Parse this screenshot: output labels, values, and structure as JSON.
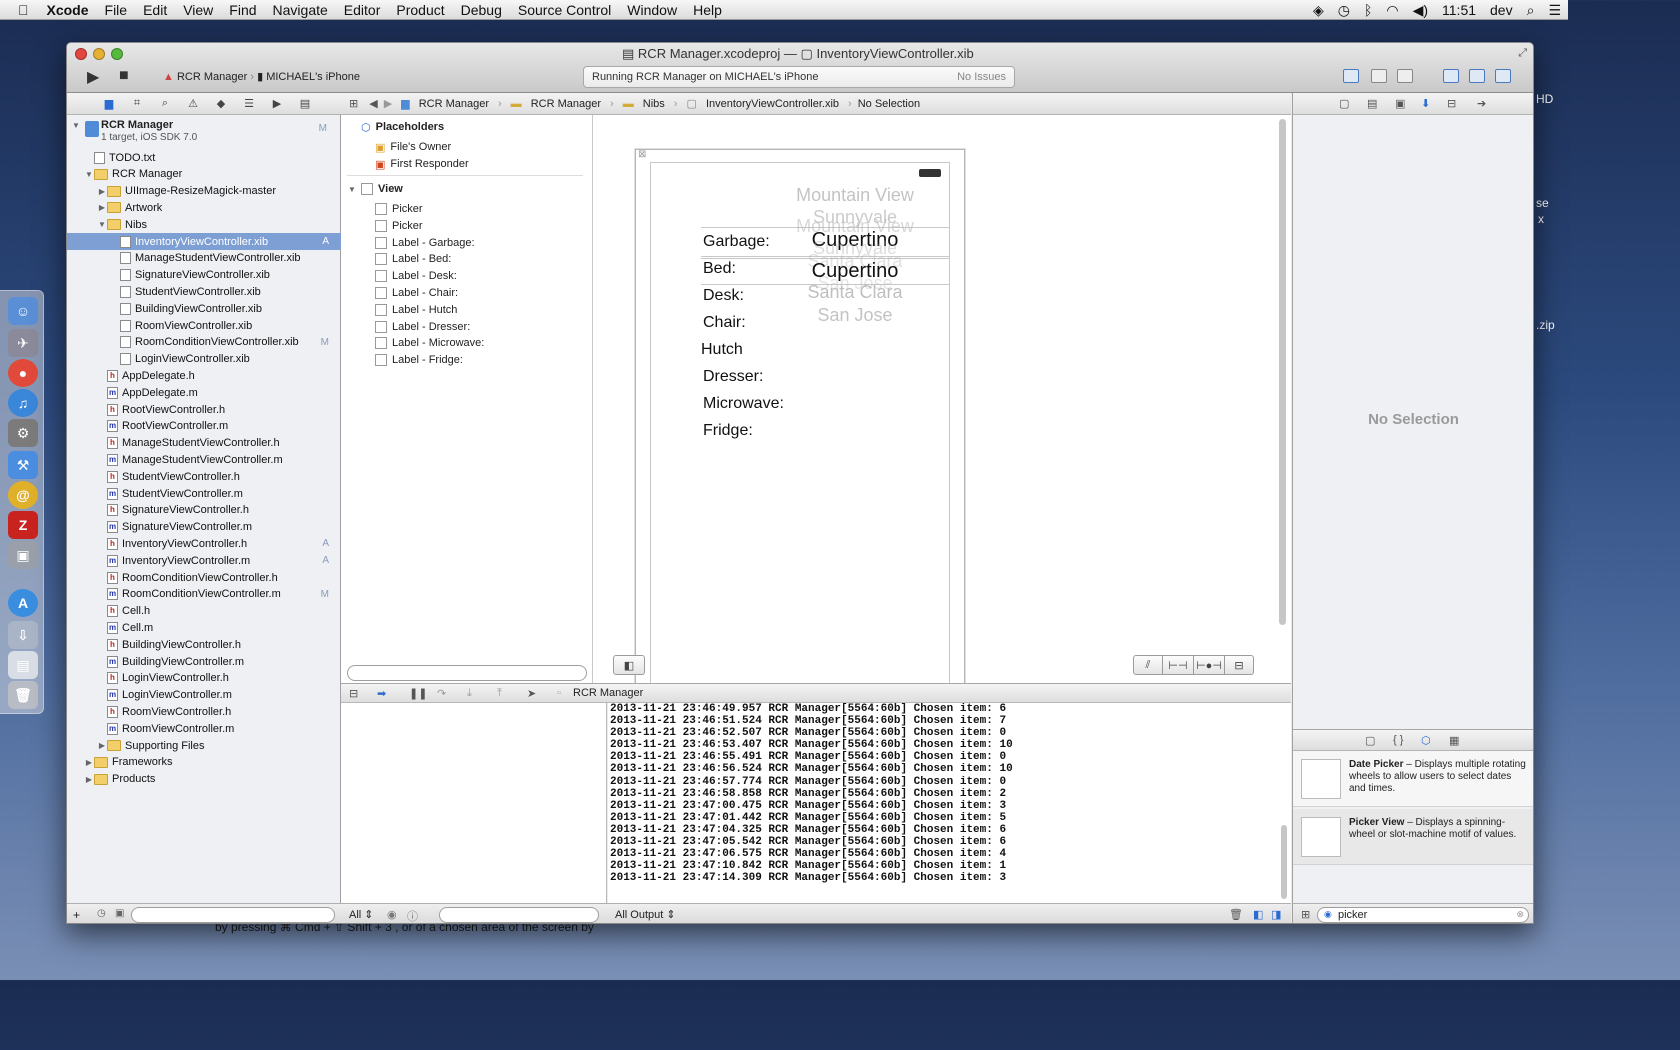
{
  "menubar": {
    "apple": "",
    "app": "Xcode",
    "items": [
      "File",
      "Edit",
      "View",
      "Find",
      "Navigate",
      "Editor",
      "Product",
      "Debug",
      "Source Control",
      "Window",
      "Help"
    ],
    "clock": "11:51",
    "user": "dev"
  },
  "desktop": {
    "hd": "HD",
    "se": "se",
    "x": "x",
    "zip": ".zip",
    "caption": "by pressing ⌘ Cmd + ⇧ Shift + 3 , or of a chosen area of the screen by"
  },
  "window": {
    "title_project": "RCR Manager.xcodeproj",
    "title_dash": "—",
    "title_file": "InventoryViewController.xib",
    "scheme": "RCR Manager",
    "device": "MICHAEL's iPhone",
    "activity": "Running RCR Manager on MICHAEL's iPhone",
    "issues": "No Issues"
  },
  "navigator": {
    "project": {
      "name": "RCR Manager",
      "sub": "1 target, iOS SDK 7.0",
      "badge": "M"
    },
    "rows": [
      {
        "label": "TODO.txt",
        "kind": "file",
        "indent": 1
      },
      {
        "label": "RCR Manager",
        "kind": "folder",
        "indent": 1,
        "open": true
      },
      {
        "label": "UIImage-ResizeMagick-master",
        "kind": "folder",
        "indent": 2
      },
      {
        "label": "Artwork",
        "kind": "folder",
        "indent": 2
      },
      {
        "label": "Nibs",
        "kind": "folder",
        "indent": 2,
        "open": true
      },
      {
        "label": "InventoryViewController.xib",
        "kind": "xib",
        "indent": 3,
        "badge": "A",
        "selected": true
      },
      {
        "label": "ManageStudentViewController.xib",
        "kind": "xib",
        "indent": 3
      },
      {
        "label": "SignatureViewController.xib",
        "kind": "xib",
        "indent": 3
      },
      {
        "label": "StudentViewController.xib",
        "kind": "xib",
        "indent": 3
      },
      {
        "label": "BuildingViewController.xib",
        "kind": "xib",
        "indent": 3
      },
      {
        "label": "RoomViewController.xib",
        "kind": "xib",
        "indent": 3
      },
      {
        "label": "RoomConditionViewController.xib",
        "kind": "xib",
        "indent": 3,
        "badge": "M"
      },
      {
        "label": "LoginViewController.xib",
        "kind": "xib",
        "indent": 3
      },
      {
        "label": "AppDelegate.h",
        "kind": "h",
        "indent": 2
      },
      {
        "label": "AppDelegate.m",
        "kind": "m",
        "indent": 2
      },
      {
        "label": "RootViewController.h",
        "kind": "h",
        "indent": 2
      },
      {
        "label": "RootViewController.m",
        "kind": "m",
        "indent": 2
      },
      {
        "label": "ManageStudentViewController.h",
        "kind": "h",
        "indent": 2
      },
      {
        "label": "ManageStudentViewController.m",
        "kind": "m",
        "indent": 2
      },
      {
        "label": "StudentViewController.h",
        "kind": "h",
        "indent": 2
      },
      {
        "label": "StudentViewController.m",
        "kind": "m",
        "indent": 2
      },
      {
        "label": "SignatureViewController.h",
        "kind": "h",
        "indent": 2
      },
      {
        "label": "SignatureViewController.m",
        "kind": "m",
        "indent": 2
      },
      {
        "label": "InventoryViewController.h",
        "kind": "h",
        "indent": 2,
        "badge": "A"
      },
      {
        "label": "InventoryViewController.m",
        "kind": "m",
        "indent": 2,
        "badge": "A"
      },
      {
        "label": "RoomConditionViewController.h",
        "kind": "h",
        "indent": 2
      },
      {
        "label": "RoomConditionViewController.m",
        "kind": "m",
        "indent": 2,
        "badge": "M"
      },
      {
        "label": "Cell.h",
        "kind": "h",
        "indent": 2
      },
      {
        "label": "Cell.m",
        "kind": "m",
        "indent": 2
      },
      {
        "label": "BuildingViewController.h",
        "kind": "h",
        "indent": 2
      },
      {
        "label": "BuildingViewController.m",
        "kind": "m",
        "indent": 2
      },
      {
        "label": "LoginViewController.h",
        "kind": "h",
        "indent": 2
      },
      {
        "label": "LoginViewController.m",
        "kind": "m",
        "indent": 2
      },
      {
        "label": "RoomViewController.h",
        "kind": "h",
        "indent": 2
      },
      {
        "label": "RoomViewController.m",
        "kind": "m",
        "indent": 2
      },
      {
        "label": "Supporting Files",
        "kind": "folder",
        "indent": 2
      },
      {
        "label": "Frameworks",
        "kind": "folder",
        "indent": 1
      },
      {
        "label": "Products",
        "kind": "folder",
        "indent": 1
      }
    ]
  },
  "jumpbar": {
    "crumbs": [
      "RCR Manager",
      "RCR Manager",
      "Nibs",
      "InventoryViewController.xib",
      "No Selection"
    ]
  },
  "outline": {
    "placeholders": "Placeholders",
    "files_owner": "File's Owner",
    "first_responder": "First Responder",
    "view": "View",
    "items": [
      "Picker",
      "Picker",
      "Label - Garbage:",
      "Label - Bed:",
      "Label - Desk:",
      "Label - Chair:",
      "Label - Hutch",
      "Label - Dresser:",
      "Label - Microwave:",
      "Label - Fridge:"
    ]
  },
  "canvas": {
    "labels": [
      "Garbage:",
      "Bed:",
      "Desk:",
      "Chair:",
      "Hutch",
      "Dresser:",
      "Microwave:",
      "Fridge:"
    ],
    "picker1": [
      "Mountain View",
      "Sunnyvale",
      "Cupertino",
      "Santa Clara",
      "San Jose"
    ],
    "picker2": [
      "Mountain View",
      "Sunnyvale",
      "Cupertino",
      "Santa Clara",
      "San Jose"
    ]
  },
  "debug": {
    "target": "RCR Manager",
    "vars_filter": "All",
    "console_filter": "All Output",
    "log": [
      "2013-11-21 23:46:49.957 RCR Manager[5564:60b] Chosen item: 6",
      "2013-11-21 23:46:51.524 RCR Manager[5564:60b] Chosen item: 7",
      "2013-11-21 23:46:52.507 RCR Manager[5564:60b] Chosen item: 0",
      "2013-11-21 23:46:53.407 RCR Manager[5564:60b] Chosen item: 10",
      "2013-11-21 23:46:55.491 RCR Manager[5564:60b] Chosen item: 0",
      "2013-11-21 23:46:56.524 RCR Manager[5564:60b] Chosen item: 10",
      "2013-11-21 23:46:57.774 RCR Manager[5564:60b] Chosen item: 0",
      "2013-11-21 23:46:58.858 RCR Manager[5564:60b] Chosen item: 2",
      "2013-11-21 23:47:00.475 RCR Manager[5564:60b] Chosen item: 3",
      "2013-11-21 23:47:01.442 RCR Manager[5564:60b] Chosen item: 5",
      "2013-11-21 23:47:04.325 RCR Manager[5564:60b] Chosen item: 6",
      "2013-11-21 23:47:05.542 RCR Manager[5564:60b] Chosen item: 6",
      "2013-11-21 23:47:06.575 RCR Manager[5564:60b] Chosen item: 4",
      "2013-11-21 23:47:10.842 RCR Manager[5564:60b] Chosen item: 1",
      "2013-11-21 23:47:14.309 RCR Manager[5564:60b] Chosen item: 3"
    ]
  },
  "inspector": {
    "no_selection": "No Selection",
    "library": [
      {
        "title": "Date Picker",
        "desc": " – Displays multiple rotating wheels to allow users to select dates and times."
      },
      {
        "title": "Picker View",
        "desc": " – Displays a spinning-wheel or slot-machine motif of values."
      }
    ],
    "search": "picker"
  }
}
